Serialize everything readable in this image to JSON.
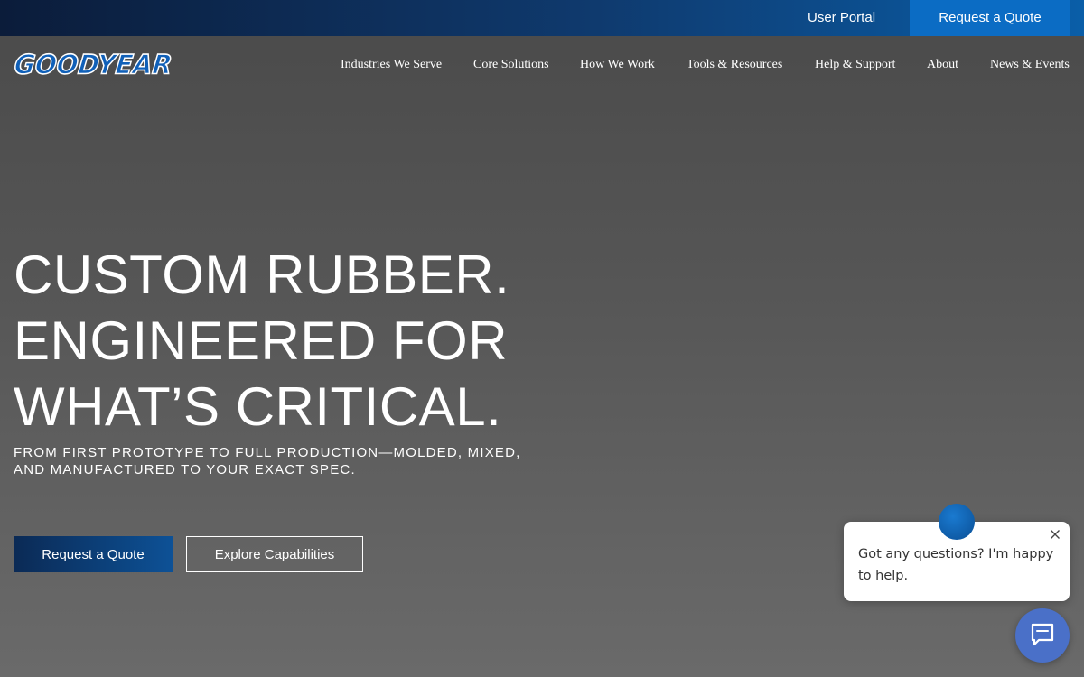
{
  "utility_bar": {
    "user_portal": "User Portal",
    "request_quote": "Request a Quote"
  },
  "header": {
    "logo_text": "GOODYEAR",
    "nav": [
      "Industries We Serve",
      "Core Solutions",
      "How We Work",
      "Tools & Resources",
      "Help & Support",
      "About",
      "News & Events"
    ]
  },
  "hero": {
    "headline": [
      "CUSTOM RUBBER.",
      "ENGINEERED FOR",
      "WHAT’S CRITICAL."
    ],
    "subheadline": [
      "FROM FIRST PROTOTYPE TO FULL PRODUCTION—MOLDED, MIXED,",
      "AND MANUFACTURED TO YOUR EXACT SPEC."
    ],
    "primary_cta": "Request a Quote",
    "secondary_cta": "Explore Capabilities"
  },
  "chat": {
    "message": "Got any questions? I'm happy to help.",
    "icons": {
      "avatar": "chat-avatar-icon",
      "close": "close-icon",
      "launcher": "chat-launcher-icon"
    }
  },
  "colors": {
    "utility_bar_start": "#0b1c3a",
    "utility_bar_end": "#0a5ea8",
    "quote_button": "#0b6cc4",
    "logo_blue": "#1060b8",
    "launcher": "#4a70c8"
  }
}
